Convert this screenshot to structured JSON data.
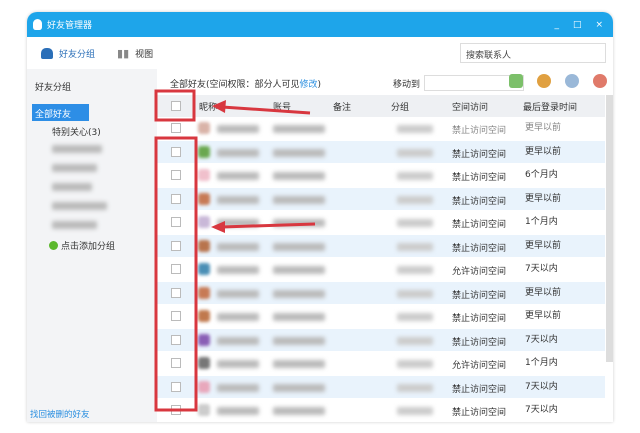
{
  "window": {
    "title": "好友管理器",
    "minimize": "_",
    "maximize": "□",
    "close": "×"
  },
  "toolbar": {
    "groups": "好友分组",
    "view": "视图",
    "search_placeholder": "搜索联系人"
  },
  "sidebar": {
    "heading": "好友分组",
    "all_friends": "全部好友",
    "special": "特别关心(3)",
    "add_group": "点击添加分组",
    "recover": "找回被删的好友"
  },
  "main": {
    "all_prefix": "全部好友(空间权限：部分人可见",
    "modify": "修改",
    "all_suffix": ")",
    "move_to": "移动到"
  },
  "columns": [
    "昵称",
    "账号",
    "备注",
    "分组",
    "空间访问",
    "最后登录时间"
  ],
  "rows": [
    {
      "access": "禁止访问空间",
      "last": "更早以前",
      "avatar": "#d9b3a8"
    },
    {
      "access": "禁止访问空间",
      "last": "更早以前",
      "avatar": "#6aa84f"
    },
    {
      "access": "禁止访问空间",
      "last": "6个月内",
      "avatar": "#f0c0cc"
    },
    {
      "access": "禁止访问空间",
      "last": "更早以前",
      "avatar": "#c77a55"
    },
    {
      "access": "禁止访问空间",
      "last": "1个月内",
      "avatar": "#c9b8d8"
    },
    {
      "access": "禁止访问空间",
      "last": "更早以前",
      "avatar": "#b8744d"
    },
    {
      "access": "允许访问空间",
      "last": "7天以内",
      "avatar": "#4a8fb5"
    },
    {
      "access": "禁止访问空间",
      "last": "更早以前",
      "avatar": "#c77a55"
    },
    {
      "access": "禁止访问空间",
      "last": "更早以前",
      "avatar": "#c0794d"
    },
    {
      "access": "禁止访问空间",
      "last": "7天以内",
      "avatar": "#8a5fb5"
    },
    {
      "access": "允许访问空间",
      "last": "1个月内",
      "avatar": "#777777"
    },
    {
      "access": "禁止访问空间",
      "last": "7天以内",
      "avatar": "#e8a8bc"
    },
    {
      "access": "禁止访问空间",
      "last": "7天以内",
      "avatar": "#cccccc"
    }
  ],
  "colors": {
    "titlebar": "#1ea5ea",
    "selected": "#2d8ee6",
    "row_alt": "#e9f3fc",
    "annotation": "#d8373f"
  }
}
